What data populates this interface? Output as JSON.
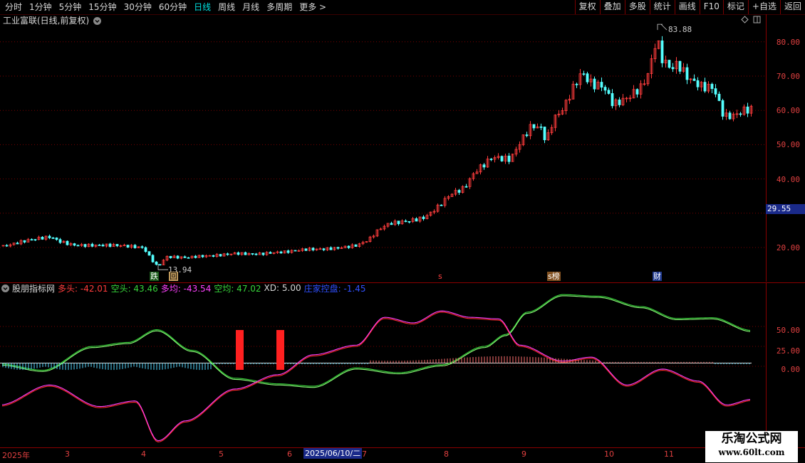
{
  "toolbar": {
    "periods": [
      "分时",
      "1分钟",
      "5分钟",
      "15分钟",
      "30分钟",
      "60分钟",
      "日线",
      "周线",
      "月线",
      "多周期",
      "更多"
    ],
    "active_period": "日线",
    "more_arrow": ">",
    "actions": [
      "复权",
      "叠加",
      "多股",
      "统计",
      "画线",
      "F10",
      "标记",
      "+自选",
      "返回"
    ]
  },
  "main": {
    "title": "工业富联(日线,前复权)",
    "price_axis": [
      "80.00",
      "70.00",
      "60.00",
      "50.00",
      "40.00",
      "20.00"
    ],
    "current_price_tag": "29.55",
    "high_label": "83.88",
    "low_label": "13.94",
    "markers": {
      "die": "跌",
      "hui": "回",
      "s": "s",
      "bang": "s榜",
      "cai": "财"
    }
  },
  "indicator": {
    "name": "股朋指标网",
    "duotou": "多头: -42.01",
    "kongtou": "空头: 43.46",
    "duojun": "多均: -43.54",
    "kongjun": "空均: 47.02",
    "xd": "XD: 5.00",
    "zhuangjia": "庄家控盘: -1.45",
    "axis": [
      "50.00",
      "25.00",
      "0.00"
    ]
  },
  "date_axis": {
    "labels": [
      "2025年",
      "3",
      "4",
      "5",
      "6",
      "7",
      "8",
      "9",
      "10",
      "11"
    ],
    "cursor_date": "2025/06/10/二"
  },
  "watermark": {
    "line1": "乐淘公式网",
    "line2": "www.60lt.com"
  },
  "colors": {
    "up": "#ff3c3c",
    "down": "#54ffff",
    "grid": "#7a0000",
    "green": "#37d53a",
    "pink": "#ff40ff",
    "red": "#ff2020"
  }
}
